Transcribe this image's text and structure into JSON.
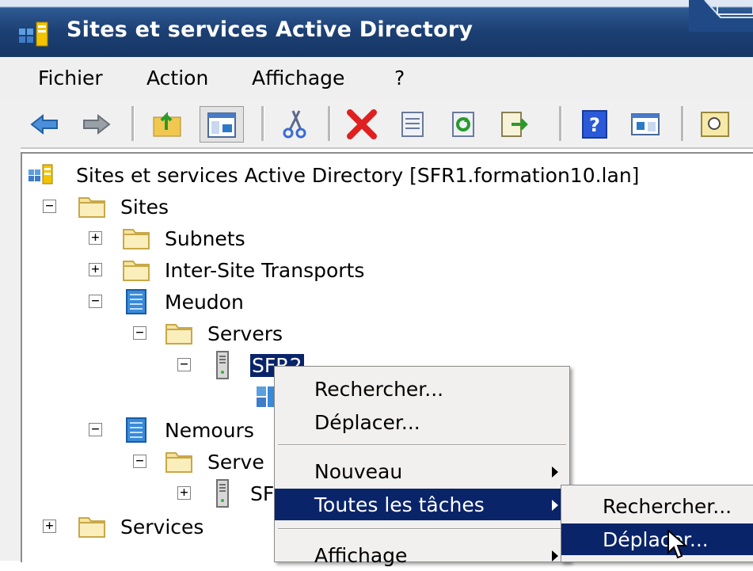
{
  "window": {
    "title": "Sites et services Active Directory"
  },
  "menubar": {
    "items": [
      "Fichier",
      "Action",
      "Affichage",
      "?"
    ]
  },
  "toolbar": {
    "buttons": [
      "back-arrow-icon",
      "forward-arrow-icon",
      "up-folder-icon",
      "show-hide-tree-icon",
      "cut-icon",
      "delete-icon",
      "properties-icon",
      "refresh-icon",
      "export-list-icon",
      "help-icon",
      "action-pane-icon",
      "find-icon"
    ]
  },
  "tree": {
    "root": "Sites et services Active Directory [SFR1.formation10.lan]",
    "sites": "Sites",
    "subnets": "Subnets",
    "inter_site": "Inter-Site Transports",
    "meudon": "Meudon",
    "meudon_servers": "Servers",
    "meudon_server": "SFR2",
    "nemours": "Nemours",
    "nemours_servers": "Serve",
    "nemours_server": "SF",
    "services": "Services",
    "expander_plus": "+",
    "expander_minus": "−"
  },
  "context_menu": {
    "rechercher": "Rechercher...",
    "deplacer": "Déplacer...",
    "nouveau": "Nouveau",
    "toutes_taches": "Toutes les tâches",
    "affichage": "Affichage"
  },
  "submenu": {
    "rechercher": "Rechercher...",
    "deplacer": "Déplacer..."
  },
  "colors": {
    "selection": "#0a246a",
    "titlebar": "#1c3f73"
  }
}
